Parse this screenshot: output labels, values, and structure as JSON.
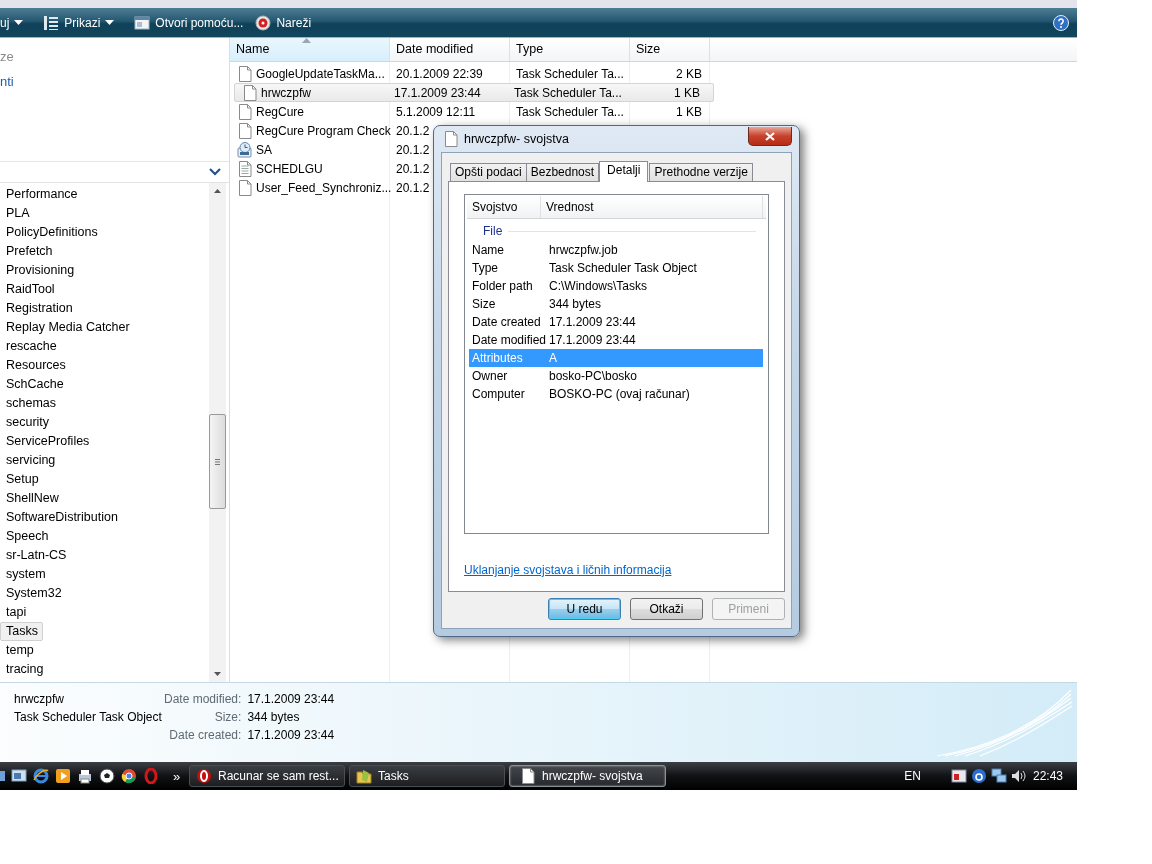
{
  "toolbar": {
    "items": [
      {
        "label": "uj",
        "kind": "menu"
      },
      {
        "label": "Prikazi",
        "kind": "menu"
      },
      {
        "label": "Otvori pomoću...",
        "kind": "button"
      },
      {
        "label": "Nareži",
        "kind": "button"
      }
    ]
  },
  "navigation": {
    "links": [
      {
        "label": "ze",
        "kind": "heading"
      },
      {
        "label": "nti",
        "kind": "link"
      }
    ],
    "folders": [
      {
        "label": "Performance",
        "selected": false
      },
      {
        "label": "PLA",
        "selected": false
      },
      {
        "label": "PolicyDefinitions",
        "selected": false
      },
      {
        "label": "Prefetch",
        "selected": false
      },
      {
        "label": "Provisioning",
        "selected": false
      },
      {
        "label": "RaidTool",
        "selected": false
      },
      {
        "label": "Registration",
        "selected": false
      },
      {
        "label": "Replay Media Catcher",
        "selected": false
      },
      {
        "label": "rescache",
        "selected": false
      },
      {
        "label": "Resources",
        "selected": false
      },
      {
        "label": "SchCache",
        "selected": false
      },
      {
        "label": "schemas",
        "selected": false
      },
      {
        "label": "security",
        "selected": false
      },
      {
        "label": "ServiceProfiles",
        "selected": false
      },
      {
        "label": "servicing",
        "selected": false
      },
      {
        "label": "Setup",
        "selected": false
      },
      {
        "label": "ShellNew",
        "selected": false
      },
      {
        "label": "SoftwareDistribution",
        "selected": false
      },
      {
        "label": "Speech",
        "selected": false
      },
      {
        "label": "sr-Latn-CS",
        "selected": false
      },
      {
        "label": "system",
        "selected": false
      },
      {
        "label": "System32",
        "selected": false
      },
      {
        "label": "tapi",
        "selected": false
      },
      {
        "label": "Tasks",
        "selected": true
      },
      {
        "label": "temp",
        "selected": false
      },
      {
        "label": "tracing",
        "selected": false
      }
    ]
  },
  "file_list": {
    "columns": [
      {
        "label": "Name",
        "sorted": true
      },
      {
        "label": "Date modified",
        "sorted": false
      },
      {
        "label": "Type",
        "sorted": false
      },
      {
        "label": "Size",
        "sorted": false
      }
    ],
    "rows": [
      {
        "kind": "document",
        "name": "GoogleUpdateTaskMa...",
        "date": "20.1.2009 22:39",
        "type": "Task Scheduler Ta...",
        "size": "2 KB",
        "selected": false
      },
      {
        "kind": "document",
        "name": "hrwczpfw",
        "date": "17.1.2009 23:44",
        "type": "Task Scheduler Ta...",
        "size": "1 KB",
        "selected": true
      },
      {
        "kind": "document",
        "name": "RegCure",
        "date": "5.1.2009 12:11",
        "type": "Task Scheduler Ta...",
        "size": "1 KB",
        "selected": false
      },
      {
        "kind": "document",
        "name": "RegCure Program Check",
        "date": "20.1.2",
        "selected": false
      },
      {
        "kind": "scheduled",
        "name": "SA",
        "date": "20.1.2",
        "selected": false
      },
      {
        "kind": "text",
        "name": "SCHEDLGU",
        "date": "20.1.2",
        "selected": false
      },
      {
        "kind": "document",
        "name": "User_Feed_Synchroniz...",
        "date": "20.1.2",
        "selected": false
      }
    ]
  },
  "details_pane": {
    "name": "hrwczpfw",
    "type": "Task Scheduler Task Object",
    "fields": [
      {
        "label": "Date modified:",
        "value": "17.1.2009 23:44"
      },
      {
        "label": "Size:",
        "value": "344 bytes"
      },
      {
        "label": "Date created:",
        "value": "17.1.2009 23:44"
      }
    ]
  },
  "dialog": {
    "title": "hrwczpfw- svojstva",
    "tabs": [
      {
        "label": "Opšti podaci",
        "selected": false
      },
      {
        "label": "Bezbednost",
        "selected": false
      },
      {
        "label": "Detalji",
        "selected": true
      },
      {
        "label": "Prethodne verzije",
        "selected": false
      }
    ],
    "columns": [
      "Svojstvo",
      "Vrednost"
    ],
    "group": "File",
    "properties": [
      {
        "name": "Name",
        "value": "hrwczpfw.job",
        "selected": false
      },
      {
        "name": "Type",
        "value": "Task Scheduler Task Object",
        "selected": false
      },
      {
        "name": "Folder path",
        "value": "C:\\Windows\\Tasks",
        "selected": false
      },
      {
        "name": "Size",
        "value": "344 bytes",
        "selected": false
      },
      {
        "name": "Date created",
        "value": "17.1.2009 23:44",
        "selected": false
      },
      {
        "name": "Date modified",
        "value": "17.1.2009 23:44",
        "selected": false
      },
      {
        "name": "Attributes",
        "value": "A",
        "selected": true
      },
      {
        "name": "Owner",
        "value": "bosko-PC\\bosko",
        "selected": false
      },
      {
        "name": "Computer",
        "value": "BOSKO-PC (ovaj računar)",
        "selected": false
      }
    ],
    "link": "Uklanjanje svojstava i ličnih informacija",
    "buttons": [
      {
        "label": "U redu",
        "kind": "default"
      },
      {
        "label": "Otkaži",
        "kind": "normal"
      },
      {
        "label": "Primeni",
        "kind": "disabled"
      }
    ]
  },
  "taskbar": {
    "overflow": "»",
    "tasks": [
      {
        "label": "Racunar se sam rest...",
        "selected": false
      },
      {
        "label": "Tasks",
        "selected": false
      },
      {
        "label": "hrwczpfw- svojstva",
        "selected": true
      }
    ],
    "language": "EN",
    "clock": "22:43"
  }
}
